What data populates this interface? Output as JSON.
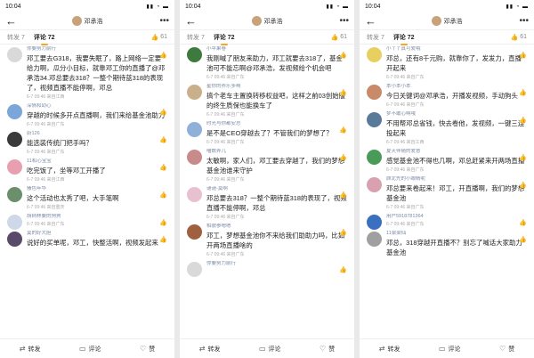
{
  "panels": [
    {
      "status_time": "10:04",
      "header_name": "邓承浩",
      "tab_repost": "转发 7",
      "tab_comment": "评论 72",
      "likes": "61",
      "comments": [
        {
          "name": "你要努力前行",
          "text": "邓工要去G318，我要失眠了，路上网络一定要给力啊，瓜分小目标，就靠邓工你的直播了@邓承浩34.邓总要去318？一整个期待蓝318的表现了，视频直播不能停啊，邓总",
          "meta": "6-7 09:46 来自江西",
          "color": "#d9d9d9"
        },
        {
          "name": "深情和幼心",
          "text": "穿越的时候多开点直播啊，我们来给基金池助力",
          "meta": "6-7 09:46 来自广东",
          "color": "#7aa6d9"
        },
        {
          "name": "蔚126",
          "text": "能选装传统门把手吗？",
          "meta": "6-7 09:46 来自广东",
          "color": "#3a3a3a"
        },
        {
          "name": "11和心宝宝",
          "text": "吃完饭了，坐等邓工开播了",
          "meta": "6-7 09:46 来自江西",
          "color": "#e8a0b0"
        },
        {
          "name": "骚色年华",
          "text": "这个活动也太秀了吧，大手笔啊",
          "meta": "6-7 09:46 来自重庆",
          "color": "#6a8f6a"
        },
        {
          "name": "胡柄林要的狗狗",
          "text": "",
          "meta": "6-7 09:46 来自广东",
          "color": "#cfd8e8"
        },
        {
          "name": "莫的好大胆",
          "text": "说好的买单呢，邓工，快整活啊，视频发起来",
          "meta": "",
          "color": "#5a4a6a"
        }
      ]
    },
    {
      "status_time": "10:04",
      "header_name": "邓承浩",
      "tab_repost": "转发 7",
      "tab_comment": "评论 72",
      "likes": "61",
      "comments": [
        {
          "name": "小苹果卷",
          "text": "我刚喊了朋友来助力，邓工就要去318了，基金池可不能忘啊@邓承浩，发视频给个机会吧",
          "meta": "6-7 09:46 来自广东",
          "color": "#3d7a3d"
        },
        {
          "name": "星你的养乐多啊",
          "text": "搞个老车主置换转移权益吧，这样之前03创始版的终生质保也能换车了",
          "meta": "6-7 09:46 来自广东",
          "color": "#c9b08a"
        },
        {
          "name": "时光与你都安总",
          "text": "是不是CEO穿越去了？不管我们的梦想了？",
          "meta": "6-7 09:46 来自广东",
          "color": "#8fb0d9"
        },
        {
          "name": "喵数弄儿",
          "text": "太敏啊，家人们，邓工要去穿越了，我们的梦想基金池谁来守护",
          "meta": "6-7 09:46 来自广东",
          "color": "#c98a8a"
        },
        {
          "name": "谜谜-莫啊",
          "text": "邓总要去318？一整个期待蓝318的表现了，视频直播不能停啊，邓总",
          "meta": "6-7 09:46 来自广东",
          "color": "#e8c0d0"
        },
        {
          "name": "相貌参嗯嗯",
          "text": "邓工，梦想基金池你不来给我们助助力吗，比如开两场直播啥的",
          "meta": "6-7 09:46 来自广东",
          "color": "#a06040"
        },
        {
          "name": "你要努力前行",
          "text": "",
          "meta": "",
          "color": "#d9d9d9"
        }
      ]
    },
    {
      "status_time": "10:04",
      "header_name": "邓承浩",
      "tab_repost": "转发 7",
      "tab_comment": "评论 72",
      "likes": "61",
      "comments": [
        {
          "name": "小丫丫真可爱哦",
          "text": "邓总，还有8千元购，就靠你了，发发力，直播开起来",
          "meta": "6-7 09:46 来自广东",
          "color": "#e8d060"
        },
        {
          "name": "本小本小本",
          "text": "今日关键词@邓承浩，开播发视频，手动狗头",
          "meta": "6-7 09:46 来自广东",
          "color": "#c98a6a"
        },
        {
          "name": "梦不敢心啊哦",
          "text": "不用帮邓总省钱，快去卷他，发视频，一键三连投起来",
          "meta": "6-7 09:46 来自江西",
          "color": "#5a7a9a"
        },
        {
          "name": "夏天伴随的爱意",
          "text": "感觉基金池不得也几啊，邓总赶紧来开两场直播",
          "meta": "6-7 09:46 来自广东",
          "color": "#4a9a5a"
        },
        {
          "name": "顾北先的小眼睛呢",
          "text": "邓总要来卷起来！邓工，开直播啊，我们的梦想基金池",
          "meta": "6-7 09:46 来自广东",
          "color": "#d9a0b0"
        },
        {
          "name": "用户5918781364",
          "text": "",
          "meta": "6-7 09:46 来自广东",
          "color": "#3a70c0"
        },
        {
          "name": "11梁梁仙",
          "text": "邓总，318穿越开直播不？别忘了喊话大家助力基金池",
          "meta": "",
          "color": "#a0a0a0"
        }
      ]
    }
  ],
  "bottom": {
    "repost": "转发",
    "comment": "评论",
    "like": "赞"
  }
}
